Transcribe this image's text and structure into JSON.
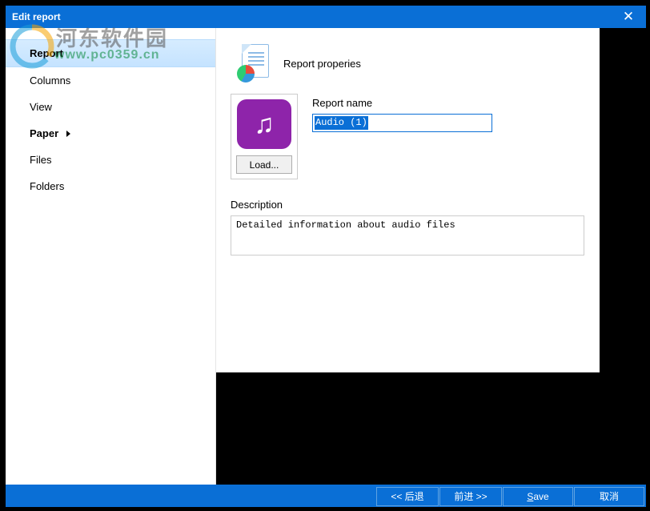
{
  "watermark": {
    "cn": "河东软件园",
    "url": "www.pc0359.cn"
  },
  "window": {
    "title": "Edit report"
  },
  "sidebar": {
    "items": [
      {
        "label": "Report",
        "active": true
      },
      {
        "label": "Columns"
      },
      {
        "label": "View"
      },
      {
        "label": "Paper",
        "bold": true,
        "arrow": true
      },
      {
        "label": "Files"
      },
      {
        "label": "Folders"
      }
    ]
  },
  "content": {
    "header_title": "Report properies",
    "load_label": "Load...",
    "name_label": "Report name",
    "name_value": "Audio (1)",
    "desc_label": "Description",
    "desc_value": "Detailed information about audio files"
  },
  "footer": {
    "back": "<< 后退",
    "forward": "前进 >>",
    "save_prefix": "S",
    "save_rest": "ave",
    "cancel": "取消"
  }
}
